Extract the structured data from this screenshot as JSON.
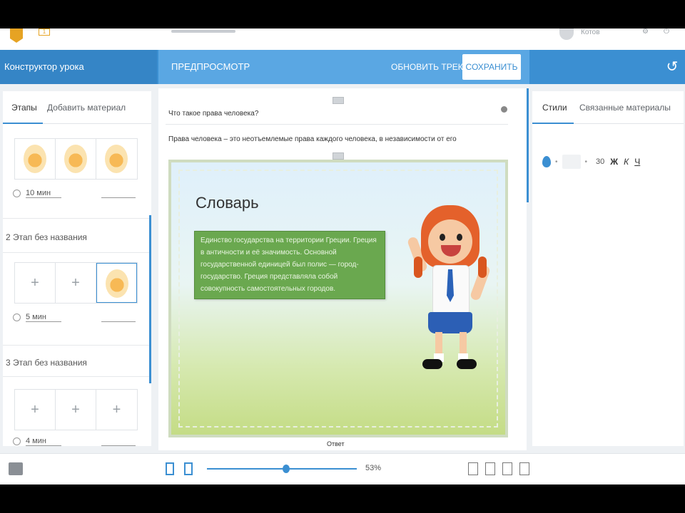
{
  "topbar": {
    "logo_badge": "1",
    "user_name": "Котов"
  },
  "header": {
    "left_title": "Конструктор урока",
    "preview_tab": "ПРЕДПРОСМОТР",
    "clear_button": "ОБНОВИТЬ ТРЕКИ",
    "save_button": "СОХРАНИТЬ",
    "history_icon": "history-icon"
  },
  "left_panel": {
    "tabs": [
      "Этапы",
      "Добавить материал"
    ],
    "stages": [
      {
        "title": "",
        "duration": "10 мин",
        "slots": [
          "egg",
          "egg",
          "egg"
        ]
      },
      {
        "title": "2  Этап без названия",
        "duration": "5 мин",
        "slots": [
          "plus",
          "plus",
          "egg"
        ]
      },
      {
        "title": "3  Этап без названия",
        "duration": "4 мин",
        "slots": [
          "plus",
          "plus",
          "plus"
        ]
      }
    ],
    "plus_symbol": "+"
  },
  "center": {
    "question": "Что такое права человека?",
    "answer_text": "Права человека – это неотъемлемые права каждого человека, в независимости от его",
    "slide_title": "Словарь",
    "vocab_text": "Единство государства на территории Греции. Греция в античности и её значимость. Основной государственной единицей был полис — город-государство. Греция представляла собой совокупность самостоятельных городов.",
    "answer_label": "Ответ"
  },
  "right_panel": {
    "tabs": [
      "Стили",
      "Связанные материалы"
    ],
    "font_size": "30",
    "bold": "Ж",
    "italic": "К",
    "underline": "Ч"
  },
  "bottombar": {
    "zoom": "53%",
    "zoom_fraction": 0.53
  },
  "colors": {
    "accent": "#3b8fd2",
    "vocab_green": "#6aa84f",
    "hair": "#e4612b"
  }
}
